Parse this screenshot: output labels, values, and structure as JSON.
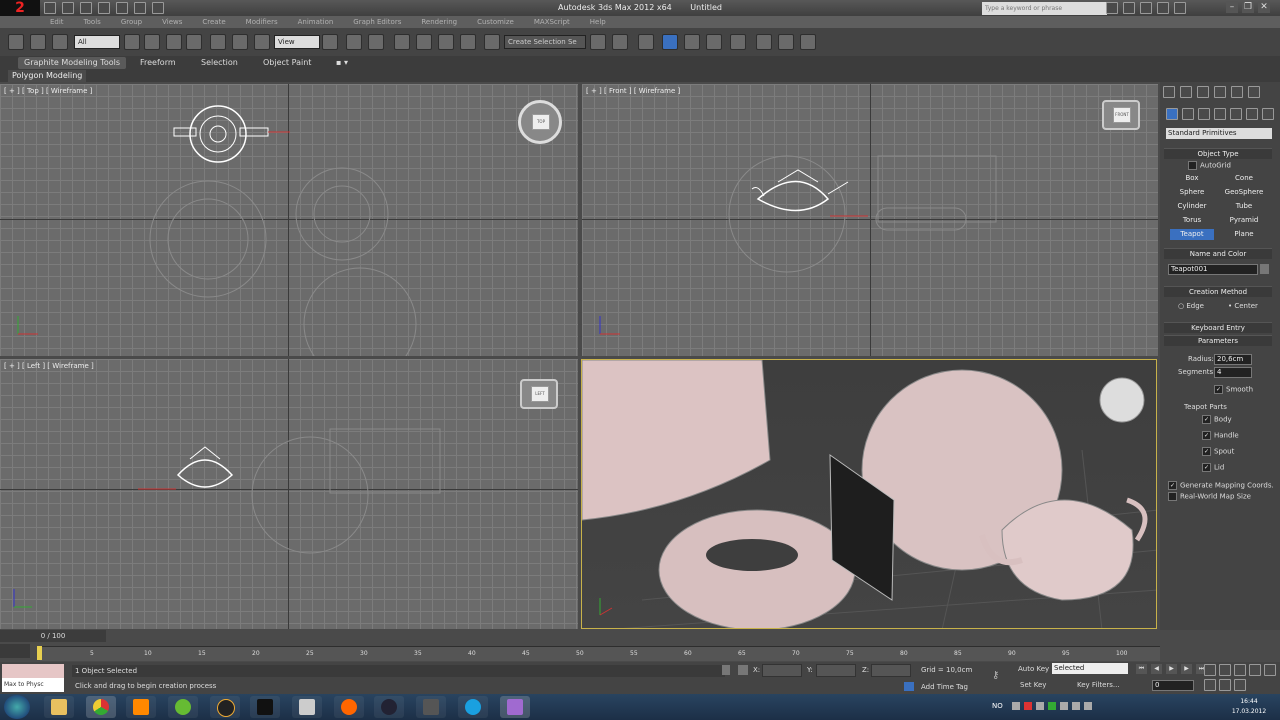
{
  "window": {
    "app": "Autodesk 3ds Max 2012 x64",
    "doc": "Untitled",
    "search_placeholder": "Type a keyword or phrase"
  },
  "menu": [
    "Edit",
    "Tools",
    "Group",
    "Views",
    "Create",
    "Modifiers",
    "Animation",
    "Graph Editors",
    "Rendering",
    "Customize",
    "MAXScript",
    "Help"
  ],
  "toolbar": {
    "filter_value": "All",
    "refcoord_value": "View",
    "selection_set_placeholder": "Create Selection Se"
  },
  "ribbon": {
    "tabs": [
      "Graphite Modeling Tools",
      "Freeform",
      "Selection",
      "Object Paint"
    ],
    "panel_label": "Polygon Modeling"
  },
  "viewports": {
    "top": "[ + ] [ Top ] [ Wireframe ]",
    "front": "[ + ] [ Front ] [ Wireframe ]",
    "left": "[ + ] [ Left ] [ Wireframe ]",
    "cube_top": "TOP",
    "cube_front": "FRONT",
    "cube_left": "LEFT"
  },
  "command_panel": {
    "category": "Standard Primitives",
    "object_type_title": "Object Type",
    "autogrid": "AutoGrid",
    "primitives": [
      "Box",
      "Cone",
      "Sphere",
      "GeoSphere",
      "Cylinder",
      "Tube",
      "Torus",
      "Pyramid",
      "Teapot",
      "Plane"
    ],
    "selected_primitive": "Teapot",
    "name_color_title": "Name and Color",
    "object_name": "Teapot001",
    "creation_method_title": "Creation Method",
    "creation_methods": [
      "Edge",
      "Center"
    ],
    "keyboard_entry_title": "Keyboard Entry",
    "parameters_title": "Parameters",
    "radius_label": "Radius:",
    "radius_value": "20,6cm",
    "segments_label": "Segments:",
    "segments_value": "4",
    "smooth_label": "Smooth",
    "teapot_parts_label": "Teapot Parts",
    "parts": [
      "Body",
      "Handle",
      "Spout",
      "Lid"
    ],
    "gen_mapping": "Generate Mapping Coords.",
    "real_world": "Real-World Map Size"
  },
  "timeline": {
    "slider": "0 / 100",
    "ticks": [
      "5",
      "10",
      "15",
      "20",
      "25",
      "30",
      "35",
      "40",
      "45",
      "50",
      "55",
      "60",
      "65",
      "70",
      "75",
      "80",
      "85",
      "90",
      "95",
      "100"
    ],
    "progress": 0
  },
  "status": {
    "maxscript": "Max to Physc",
    "selected": "1 Object Selected",
    "prompt": "Click and drag to begin creation process",
    "x_label": "X:",
    "y_label": "Y:",
    "z_label": "Z:",
    "grid": "Grid = 10,0cm",
    "add_time_tag": "Add Time Tag",
    "auto_key": "Auto Key",
    "set_key": "Set Key",
    "key_mode": "Selected",
    "key_filters": "Key Filters...",
    "frame": "0"
  },
  "taskbar": {
    "lang": "NO",
    "time": "16:44",
    "date": "17.03.2012"
  }
}
